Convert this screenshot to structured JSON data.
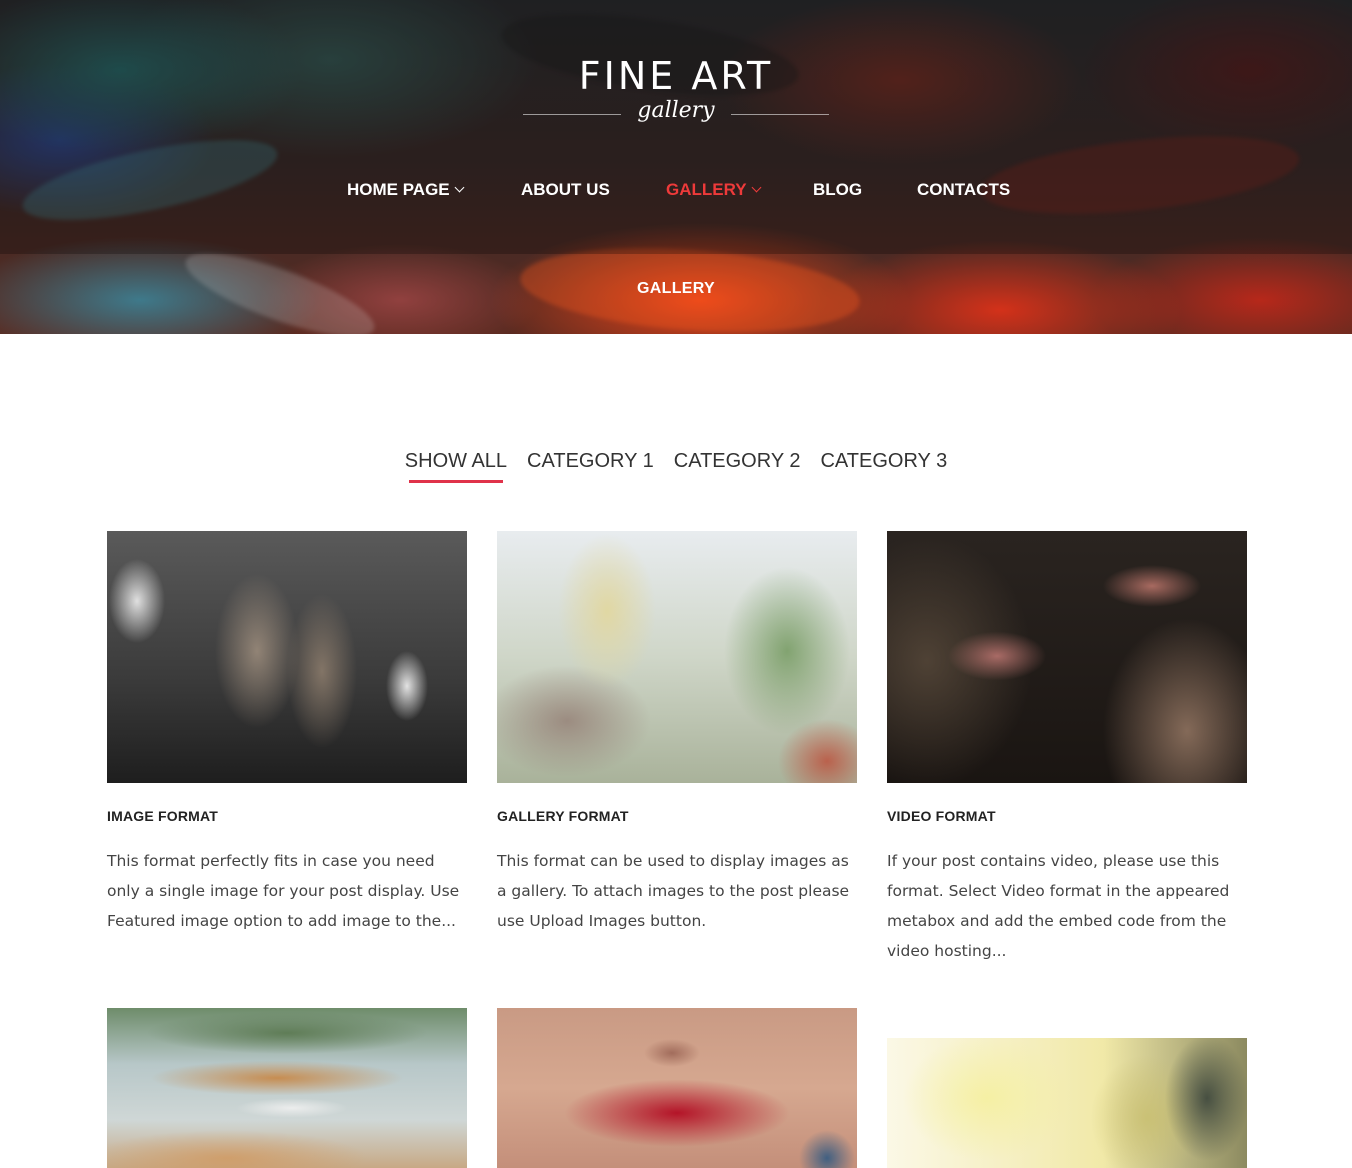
{
  "logo": {
    "title": "FINE ART",
    "subtitle": "gallery"
  },
  "nav": {
    "items": [
      {
        "label": "HOME PAGE",
        "has_dropdown": true,
        "active": false
      },
      {
        "label": "ABOUT US",
        "has_dropdown": false,
        "active": false
      },
      {
        "label": "GALLERY",
        "has_dropdown": true,
        "active": true
      },
      {
        "label": "BLOG",
        "has_dropdown": false,
        "active": false
      },
      {
        "label": "CONTACTS",
        "has_dropdown": false,
        "active": false
      }
    ]
  },
  "page": {
    "title": "GALLERY"
  },
  "filters": {
    "items": [
      "SHOW ALL",
      "CATEGORY 1",
      "CATEGORY 2",
      "CATEGORY 3"
    ],
    "selected": "SHOW ALL"
  },
  "posts": [
    {
      "title": "IMAGE FORMAT",
      "excerpt": "This format perfectly fits in case you need only a single image for your post display. Use Featured image option to add image to the..."
    },
    {
      "title": "GALLERY FORMAT",
      "excerpt": "This format can be used to display images as a gallery. To attach images to the post please use Upload Images button."
    },
    {
      "title": "VIDEO FORMAT",
      "excerpt": "If your post contains video, please use this format. Select Video format in the appeared metabox and add the embed code from the video hosting..."
    }
  ],
  "colors": {
    "accent": "#e0324a",
    "nav_active": "#ee3a3a",
    "text": "#444444"
  }
}
